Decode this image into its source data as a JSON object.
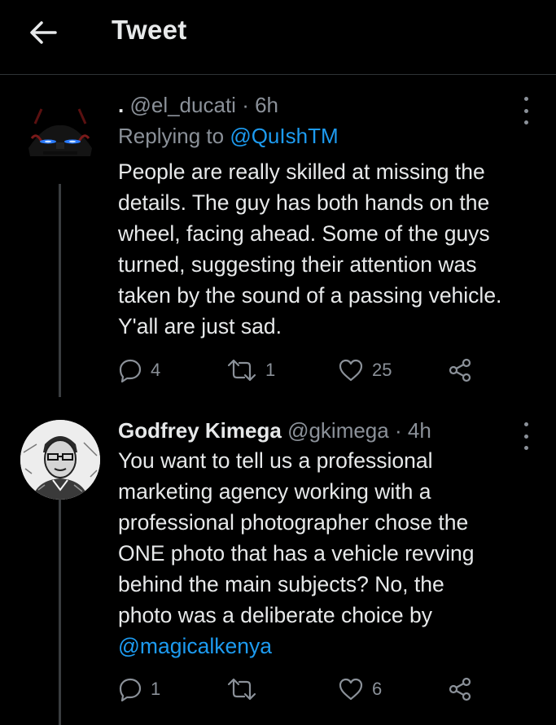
{
  "header": {
    "back_icon": "arrow-left-icon",
    "title": "Tweet"
  },
  "tweets": [
    {
      "name": ".",
      "handle": "@el_ducati",
      "separator": "·",
      "time": "6h",
      "replying_prefix": "Replying to",
      "replying_to": "@QuIshTM",
      "text_lines": [
        "People are really skilled at missing the",
        "details. The guy has both hands on the",
        "wheel, facing ahead. Some of the guys",
        "turned, suggesting their attention was",
        "taken by the sound of a passing vehicle.",
        "Y'all are just sad."
      ],
      "replies": "4",
      "retweets": "1",
      "likes": "25"
    },
    {
      "name": "Godfrey Kimega",
      "handle": "@gkimega",
      "separator": "·",
      "time": "4h",
      "text_lines": [
        "You want to tell us a professional",
        "marketing agency working with a",
        "professional photographer chose the",
        "ONE photo that has a vehicle revving",
        "behind the main subjects? No, the",
        "photo was a deliberate choice by"
      ],
      "mention": "@magicalkenya",
      "replies": "1",
      "retweets": "",
      "likes": "6"
    }
  ],
  "icons": {
    "reply": "reply-bubble-icon",
    "retweet": "retweet-icon",
    "like": "heart-icon",
    "share": "share-icon",
    "more": "more-dots-icon"
  },
  "colors": {
    "background": "#000000",
    "text": "#e7e9ea",
    "muted": "#8b9199",
    "accent": "#1d9bf0",
    "divider": "#2f3336"
  }
}
